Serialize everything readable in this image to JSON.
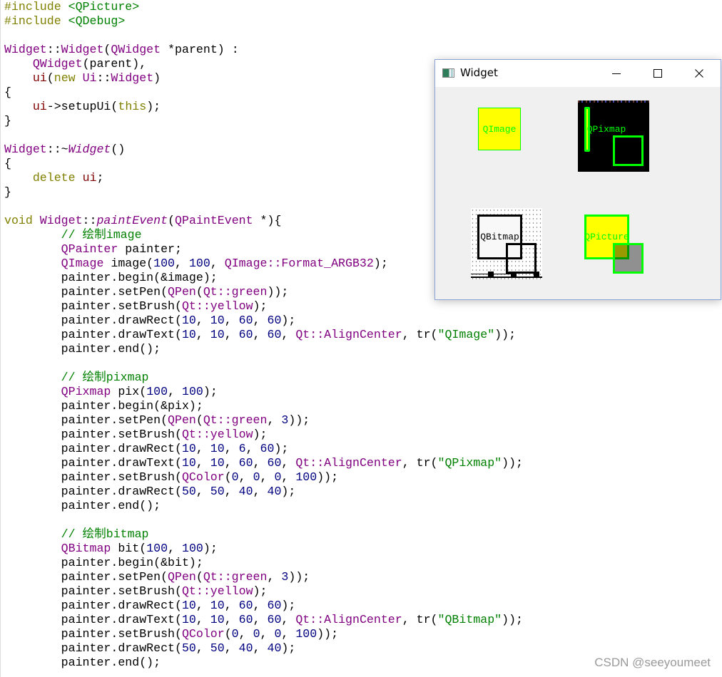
{
  "editor": {
    "lines": [
      [
        {
          "c": "kw",
          "t": "#include "
        },
        {
          "c": "str",
          "t": "<QPicture>"
        }
      ],
      [
        {
          "c": "kw",
          "t": "#include "
        },
        {
          "c": "str",
          "t": "<QDebug>"
        }
      ],
      [],
      [
        {
          "c": "ty",
          "t": "Widget"
        },
        {
          "c": "",
          "t": "::"
        },
        {
          "c": "ty",
          "t": "Widget"
        },
        {
          "c": "",
          "t": "("
        },
        {
          "c": "ty",
          "t": "QWidget"
        },
        {
          "c": "",
          "t": " *parent) :"
        }
      ],
      [
        {
          "c": "",
          "t": "    "
        },
        {
          "c": "ty",
          "t": "QWidget"
        },
        {
          "c": "",
          "t": "(parent),"
        }
      ],
      [
        {
          "c": "",
          "t": "    "
        },
        {
          "c": "mem",
          "t": "ui"
        },
        {
          "c": "",
          "t": "("
        },
        {
          "c": "kw",
          "t": "new "
        },
        {
          "c": "ty",
          "t": "Ui"
        },
        {
          "c": "",
          "t": "::"
        },
        {
          "c": "ty",
          "t": "Widget"
        },
        {
          "c": "",
          "t": ")"
        }
      ],
      [
        {
          "c": "",
          "t": "{"
        }
      ],
      [
        {
          "c": "",
          "t": "    "
        },
        {
          "c": "mem",
          "t": "ui"
        },
        {
          "c": "",
          "t": "->setupUi("
        },
        {
          "c": "kw",
          "t": "this"
        },
        {
          "c": "",
          "t": ");"
        }
      ],
      [
        {
          "c": "",
          "t": "}"
        }
      ],
      [],
      [
        {
          "c": "ty",
          "t": "Widget"
        },
        {
          "c": "",
          "t": "::~"
        },
        {
          "c": "it",
          "t": "Widget"
        },
        {
          "c": "",
          "t": "()"
        }
      ],
      [
        {
          "c": "",
          "t": "{"
        }
      ],
      [
        {
          "c": "",
          "t": "    "
        },
        {
          "c": "kw",
          "t": "delete "
        },
        {
          "c": "mem",
          "t": "ui"
        },
        {
          "c": "",
          "t": ";"
        }
      ],
      [
        {
          "c": "",
          "t": "}"
        }
      ],
      [],
      [
        {
          "c": "kw",
          "t": "void "
        },
        {
          "c": "ty",
          "t": "Widget"
        },
        {
          "c": "",
          "t": "::"
        },
        {
          "c": "it",
          "t": "paintEvent"
        },
        {
          "c": "",
          "t": "("
        },
        {
          "c": "ty",
          "t": "QPaintEvent"
        },
        {
          "c": "",
          "t": " *){"
        }
      ],
      [
        {
          "c": "",
          "t": "        "
        },
        {
          "c": "cm",
          "t": "// 绘制image"
        }
      ],
      [
        {
          "c": "",
          "t": "        "
        },
        {
          "c": "ty",
          "t": "QPainter"
        },
        {
          "c": "",
          "t": " painter;"
        }
      ],
      [
        {
          "c": "",
          "t": "        "
        },
        {
          "c": "ty",
          "t": "QImage"
        },
        {
          "c": "",
          "t": " image("
        },
        {
          "c": "num",
          "t": "100"
        },
        {
          "c": "",
          "t": ", "
        },
        {
          "c": "num",
          "t": "100"
        },
        {
          "c": "",
          "t": ", "
        },
        {
          "c": "ty",
          "t": "QImage::Format_ARGB32"
        },
        {
          "c": "",
          "t": ");"
        }
      ],
      [
        {
          "c": "",
          "t": "        painter.begin(&image);"
        }
      ],
      [
        {
          "c": "",
          "t": "        painter.setPen("
        },
        {
          "c": "ty",
          "t": "QPen"
        },
        {
          "c": "",
          "t": "("
        },
        {
          "c": "ty",
          "t": "Qt::green"
        },
        {
          "c": "",
          "t": "));"
        }
      ],
      [
        {
          "c": "",
          "t": "        painter.setBrush("
        },
        {
          "c": "ty",
          "t": "Qt::yellow"
        },
        {
          "c": "",
          "t": ");"
        }
      ],
      [
        {
          "c": "",
          "t": "        painter.drawRect("
        },
        {
          "c": "num",
          "t": "10"
        },
        {
          "c": "",
          "t": ", "
        },
        {
          "c": "num",
          "t": "10"
        },
        {
          "c": "",
          "t": ", "
        },
        {
          "c": "num",
          "t": "60"
        },
        {
          "c": "",
          "t": ", "
        },
        {
          "c": "num",
          "t": "60"
        },
        {
          "c": "",
          "t": ");"
        }
      ],
      [
        {
          "c": "",
          "t": "        painter.drawText("
        },
        {
          "c": "num",
          "t": "10"
        },
        {
          "c": "",
          "t": ", "
        },
        {
          "c": "num",
          "t": "10"
        },
        {
          "c": "",
          "t": ", "
        },
        {
          "c": "num",
          "t": "60"
        },
        {
          "c": "",
          "t": ", "
        },
        {
          "c": "num",
          "t": "60"
        },
        {
          "c": "",
          "t": ", "
        },
        {
          "c": "ty",
          "t": "Qt::AlignCenter"
        },
        {
          "c": "",
          "t": ", tr("
        },
        {
          "c": "str",
          "t": "\"QImage\""
        },
        {
          "c": "",
          "t": "));"
        }
      ],
      [
        {
          "c": "",
          "t": "        painter.end();"
        }
      ],
      [],
      [
        {
          "c": "",
          "t": "        "
        },
        {
          "c": "cm",
          "t": "// 绘制pixmap"
        }
      ],
      [
        {
          "c": "",
          "t": "        "
        },
        {
          "c": "ty",
          "t": "QPixmap"
        },
        {
          "c": "",
          "t": " pix("
        },
        {
          "c": "num",
          "t": "100"
        },
        {
          "c": "",
          "t": ", "
        },
        {
          "c": "num",
          "t": "100"
        },
        {
          "c": "",
          "t": ");"
        }
      ],
      [
        {
          "c": "",
          "t": "        painter.begin(&pix);"
        }
      ],
      [
        {
          "c": "",
          "t": "        painter.setPen("
        },
        {
          "c": "ty",
          "t": "QPen"
        },
        {
          "c": "",
          "t": "("
        },
        {
          "c": "ty",
          "t": "Qt::green"
        },
        {
          "c": "",
          "t": ", "
        },
        {
          "c": "num",
          "t": "3"
        },
        {
          "c": "",
          "t": "));"
        }
      ],
      [
        {
          "c": "",
          "t": "        painter.setBrush("
        },
        {
          "c": "ty",
          "t": "Qt::yellow"
        },
        {
          "c": "",
          "t": ");"
        }
      ],
      [
        {
          "c": "",
          "t": "        painter.drawRect("
        },
        {
          "c": "num",
          "t": "10"
        },
        {
          "c": "",
          "t": ", "
        },
        {
          "c": "num",
          "t": "10"
        },
        {
          "c": "",
          "t": ", "
        },
        {
          "c": "num",
          "t": "6"
        },
        {
          "c": "",
          "t": ", "
        },
        {
          "c": "num",
          "t": "60"
        },
        {
          "c": "",
          "t": ");"
        }
      ],
      [
        {
          "c": "",
          "t": "        painter.drawText("
        },
        {
          "c": "num",
          "t": "10"
        },
        {
          "c": "",
          "t": ", "
        },
        {
          "c": "num",
          "t": "10"
        },
        {
          "c": "",
          "t": ", "
        },
        {
          "c": "num",
          "t": "60"
        },
        {
          "c": "",
          "t": ", "
        },
        {
          "c": "num",
          "t": "60"
        },
        {
          "c": "",
          "t": ", "
        },
        {
          "c": "ty",
          "t": "Qt::AlignCenter"
        },
        {
          "c": "",
          "t": ", tr("
        },
        {
          "c": "str",
          "t": "\"QPixmap\""
        },
        {
          "c": "",
          "t": "));"
        }
      ],
      [
        {
          "c": "",
          "t": "        painter.setBrush("
        },
        {
          "c": "ty",
          "t": "QColor"
        },
        {
          "c": "",
          "t": "("
        },
        {
          "c": "num",
          "t": "0"
        },
        {
          "c": "",
          "t": ", "
        },
        {
          "c": "num",
          "t": "0"
        },
        {
          "c": "",
          "t": ", "
        },
        {
          "c": "num",
          "t": "0"
        },
        {
          "c": "",
          "t": ", "
        },
        {
          "c": "num",
          "t": "100"
        },
        {
          "c": "",
          "t": "));"
        }
      ],
      [
        {
          "c": "",
          "t": "        painter.drawRect("
        },
        {
          "c": "num",
          "t": "50"
        },
        {
          "c": "",
          "t": ", "
        },
        {
          "c": "num",
          "t": "50"
        },
        {
          "c": "",
          "t": ", "
        },
        {
          "c": "num",
          "t": "40"
        },
        {
          "c": "",
          "t": ", "
        },
        {
          "c": "num",
          "t": "40"
        },
        {
          "c": "",
          "t": ");"
        }
      ],
      [
        {
          "c": "",
          "t": "        painter.end();"
        }
      ],
      [],
      [
        {
          "c": "",
          "t": "        "
        },
        {
          "c": "cm",
          "t": "// 绘制bitmap"
        }
      ],
      [
        {
          "c": "",
          "t": "        "
        },
        {
          "c": "ty",
          "t": "QBitmap"
        },
        {
          "c": "",
          "t": " bit("
        },
        {
          "c": "num",
          "t": "100"
        },
        {
          "c": "",
          "t": ", "
        },
        {
          "c": "num",
          "t": "100"
        },
        {
          "c": "",
          "t": ");"
        }
      ],
      [
        {
          "c": "",
          "t": "        painter.begin(&bit);"
        }
      ],
      [
        {
          "c": "",
          "t": "        painter.setPen("
        },
        {
          "c": "ty",
          "t": "QPen"
        },
        {
          "c": "",
          "t": "("
        },
        {
          "c": "ty",
          "t": "Qt::green"
        },
        {
          "c": "",
          "t": ", "
        },
        {
          "c": "num",
          "t": "3"
        },
        {
          "c": "",
          "t": "));"
        }
      ],
      [
        {
          "c": "",
          "t": "        painter.setBrush("
        },
        {
          "c": "ty",
          "t": "Qt::yellow"
        },
        {
          "c": "",
          "t": ");"
        }
      ],
      [
        {
          "c": "",
          "t": "        painter.drawRect("
        },
        {
          "c": "num",
          "t": "10"
        },
        {
          "c": "",
          "t": ", "
        },
        {
          "c": "num",
          "t": "10"
        },
        {
          "c": "",
          "t": ", "
        },
        {
          "c": "num",
          "t": "60"
        },
        {
          "c": "",
          "t": ", "
        },
        {
          "c": "num",
          "t": "60"
        },
        {
          "c": "",
          "t": ");"
        }
      ],
      [
        {
          "c": "",
          "t": "        painter.drawText("
        },
        {
          "c": "num",
          "t": "10"
        },
        {
          "c": "",
          "t": ", "
        },
        {
          "c": "num",
          "t": "10"
        },
        {
          "c": "",
          "t": ", "
        },
        {
          "c": "num",
          "t": "60"
        },
        {
          "c": "",
          "t": ", "
        },
        {
          "c": "num",
          "t": "60"
        },
        {
          "c": "",
          "t": ", "
        },
        {
          "c": "ty",
          "t": "Qt::AlignCenter"
        },
        {
          "c": "",
          "t": ", tr("
        },
        {
          "c": "str",
          "t": "\"QBitmap\""
        },
        {
          "c": "",
          "t": "));"
        }
      ],
      [
        {
          "c": "",
          "t": "        painter.setBrush("
        },
        {
          "c": "ty",
          "t": "QColor"
        },
        {
          "c": "",
          "t": "("
        },
        {
          "c": "num",
          "t": "0"
        },
        {
          "c": "",
          "t": ", "
        },
        {
          "c": "num",
          "t": "0"
        },
        {
          "c": "",
          "t": ", "
        },
        {
          "c": "num",
          "t": "0"
        },
        {
          "c": "",
          "t": ", "
        },
        {
          "c": "num",
          "t": "100"
        },
        {
          "c": "",
          "t": "));"
        }
      ],
      [
        {
          "c": "",
          "t": "        painter.drawRect("
        },
        {
          "c": "num",
          "t": "50"
        },
        {
          "c": "",
          "t": ", "
        },
        {
          "c": "num",
          "t": "50"
        },
        {
          "c": "",
          "t": ", "
        },
        {
          "c": "num",
          "t": "40"
        },
        {
          "c": "",
          "t": ", "
        },
        {
          "c": "num",
          "t": "40"
        },
        {
          "c": "",
          "t": ");"
        }
      ],
      [
        {
          "c": "",
          "t": "        painter.end();"
        }
      ]
    ]
  },
  "window": {
    "title": "Widget",
    "icon": "qt-app-icon",
    "buttons": {
      "minimize": "minimize-icon",
      "maximize": "maximize-icon",
      "close": "close-icon",
      "close_glyph": "✕"
    },
    "drawings": {
      "qimage_label": "QImage",
      "qpixmap_label": "QPixmap",
      "qbitmap_label": "QBitmap",
      "qpicture_label": "QPicture"
    },
    "colors": {
      "pen": "#00ff00",
      "brush": "#ffff00",
      "overlay": "rgba(0,0,0,100)"
    }
  },
  "watermark": "CSDN @seeyoumeet"
}
